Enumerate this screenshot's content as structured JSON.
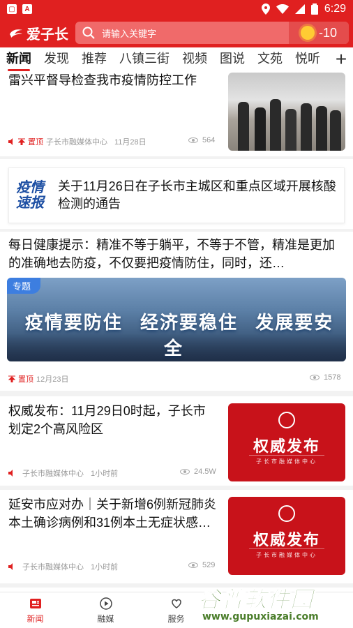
{
  "status_bar": {
    "time": "6:29"
  },
  "header": {
    "logo_text": "爱子长",
    "search_placeholder": "请输入关键字",
    "temperature": "-10"
  },
  "tabs": [
    "新闻",
    "发现",
    "推荐",
    "八镇三街",
    "视频",
    "图说",
    "文苑",
    "悦听"
  ],
  "feed": {
    "item1": {
      "title": "雷兴平督导检查我市疫情防控工作",
      "pin": "置顶",
      "source": "子长市融媒体中心",
      "date": "11月28日",
      "views": "564"
    },
    "notice": {
      "tag_line1": "疫情",
      "tag_line2": "速报",
      "text": "关于11月26日在子长市主城区和重点区域开展核酸检测的通告"
    },
    "item2": {
      "title": "每日健康提示：精准不等于躺平，不等于不管，精准是更加的准确地去防疫，不仅要把疫情防住，同时，还…",
      "banner_tag": "专题",
      "slogan1": "疫情要防住",
      "slogan2": "经济要稳住",
      "slogan3": "发展要安全",
      "pin": "置顶",
      "date": "12月23日",
      "views": "1578"
    },
    "item3": {
      "title": "权威发布：11月29日0时起，子长市划定2个高风险区",
      "thumb_title": "权威发布",
      "thumb_sub": "子长市融媒体中心",
      "source": "子长市融媒体中心",
      "time": "1小时前",
      "views": "24.5W"
    },
    "item4": {
      "title": "延安市应对办｜关于新增6例新冠肺炎本土确诊病例和31例本土无症状感…",
      "thumb_title": "权威发布",
      "thumb_sub": "子长市融媒体中心",
      "source": "子长市融媒体中心",
      "time": "1小时前",
      "views": "529"
    }
  },
  "bottom_nav": [
    "新闻",
    "融媒",
    "服务"
  ],
  "watermark": {
    "main": "谷普软件园",
    "url": "www.gupuxiazai.com"
  },
  "colors": {
    "brand_red": "#e02020",
    "notice_blue": "#1d4fa3",
    "watermark_green": "#4a7d2a"
  }
}
